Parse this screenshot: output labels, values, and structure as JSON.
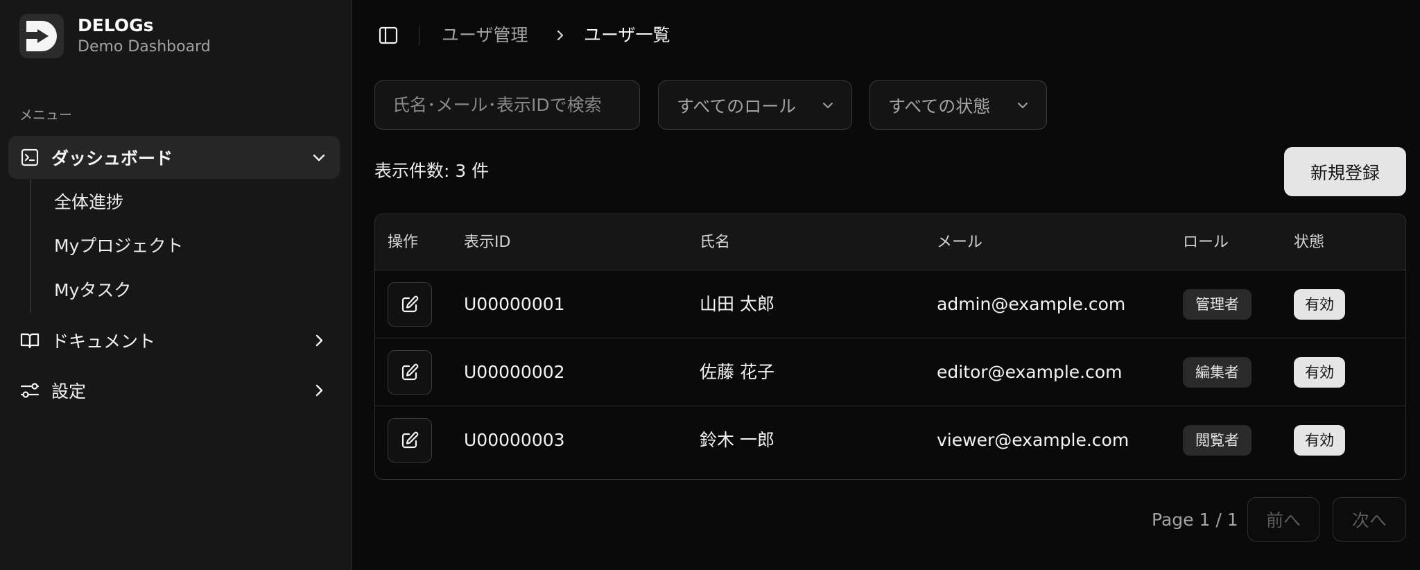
{
  "brand": {
    "title": "DELOGs",
    "subtitle": "Demo Dashboard",
    "logo_icon": "delogs-logo-icon"
  },
  "sidebar": {
    "menu_label": "メニュー",
    "items": [
      {
        "label": "ダッシュボード",
        "icon": "terminal-icon",
        "expanded": true
      },
      {
        "label": "ドキュメント",
        "icon": "book-icon",
        "expanded": false
      },
      {
        "label": "設定",
        "icon": "sliders-icon",
        "expanded": false
      }
    ],
    "sub_items": [
      {
        "label": "全体進捗"
      },
      {
        "label": "Myプロジェクト"
      },
      {
        "label": "Myタスク"
      }
    ]
  },
  "header": {
    "breadcrumb": [
      "ユーザ管理",
      "ユーザ一覧"
    ]
  },
  "filters": {
    "search_placeholder": "氏名･メール･表示IDで検索",
    "role_select": "すべてのロール",
    "status_select": "すべての状態"
  },
  "summary": {
    "count_text": "表示件数: 3 件"
  },
  "actions": {
    "new_label": "新規登録"
  },
  "table": {
    "columns": [
      "操作",
      "表示ID",
      "氏名",
      "メール",
      "ロール",
      "状態"
    ],
    "rows": [
      {
        "id": "U00000001",
        "name": "山田 太郎",
        "email": "admin@example.com",
        "role": "管理者",
        "status": "有効"
      },
      {
        "id": "U00000002",
        "name": "佐藤 花子",
        "email": "editor@example.com",
        "role": "編集者",
        "status": "有効"
      },
      {
        "id": "U00000003",
        "name": "鈴木 一郎",
        "email": "viewer@example.com",
        "role": "閲覧者",
        "status": "有効"
      }
    ]
  },
  "pagination": {
    "info": "Page 1 / 1",
    "prev_label": "前へ",
    "next_label": "次へ"
  },
  "colors": {
    "background": "#0a0a0a",
    "sidebar": "#171717",
    "accent_light": "#e5e5e5"
  }
}
